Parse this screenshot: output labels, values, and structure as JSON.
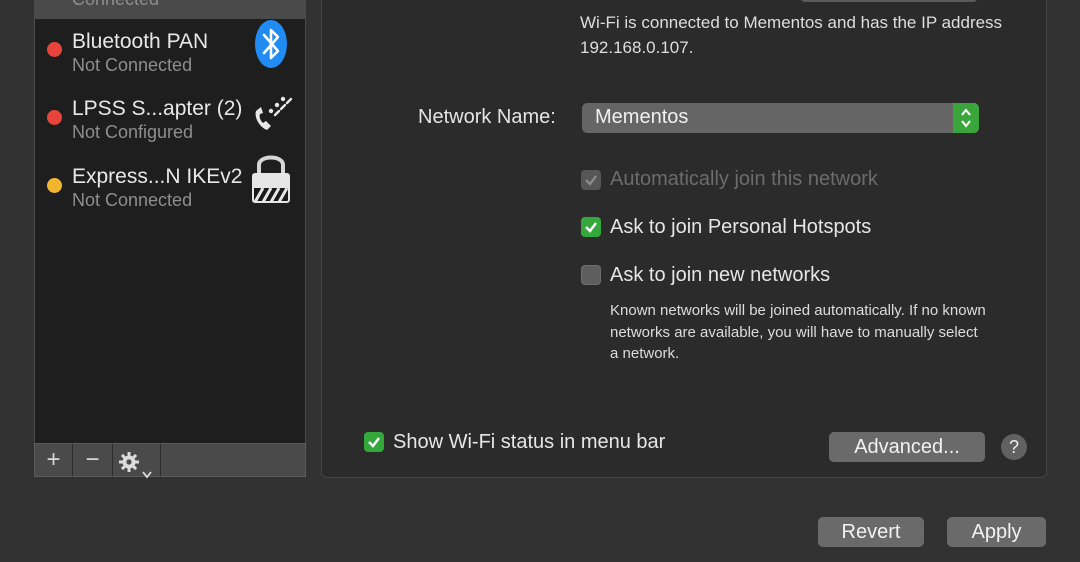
{
  "sidebar": {
    "items": [
      {
        "name": "",
        "status": "Connected",
        "dot_color": "#3cc33c",
        "icon": "wifi-icon"
      },
      {
        "name": "Bluetooth PAN",
        "status": "Not Connected",
        "dot_color": "#e9443c",
        "icon": "bluetooth-icon"
      },
      {
        "name": "LPSS S...apter (2)",
        "status": "Not Configured",
        "dot_color": "#e9443c",
        "icon": "phone-icon"
      },
      {
        "name": "Express...N IKEv2",
        "status": "Not Connected",
        "dot_color": "#f2b530",
        "icon": "lock-icon"
      }
    ],
    "toolbar": {
      "add": "+",
      "remove": "−",
      "action": "gear-icon"
    }
  },
  "status": {
    "description": "Wi-Fi is connected to Mementos and has the IP address 192.168.0.107."
  },
  "network": {
    "label": "Network Name:",
    "value": "Mementos"
  },
  "options": {
    "auto_join": {
      "label": "Automatically join this network",
      "checked": true,
      "enabled": false
    },
    "personal_hotspots": {
      "label": "Ask to join Personal Hotspots",
      "checked": true
    },
    "new_networks": {
      "label": "Ask to join new networks",
      "checked": false
    },
    "note": "Known networks will be joined automatically. If no known networks are available, you will have to manually select a network.",
    "show_status": {
      "label": "Show Wi-Fi status in menu bar",
      "checked": true
    }
  },
  "buttons": {
    "advanced": "Advanced...",
    "help": "?",
    "revert": "Revert",
    "apply": "Apply"
  },
  "colors": {
    "accent_green": "#35a83b",
    "dot_red": "#e9443c",
    "dot_yellow": "#f2b530",
    "bluetooth_blue": "#1f8bf3"
  }
}
